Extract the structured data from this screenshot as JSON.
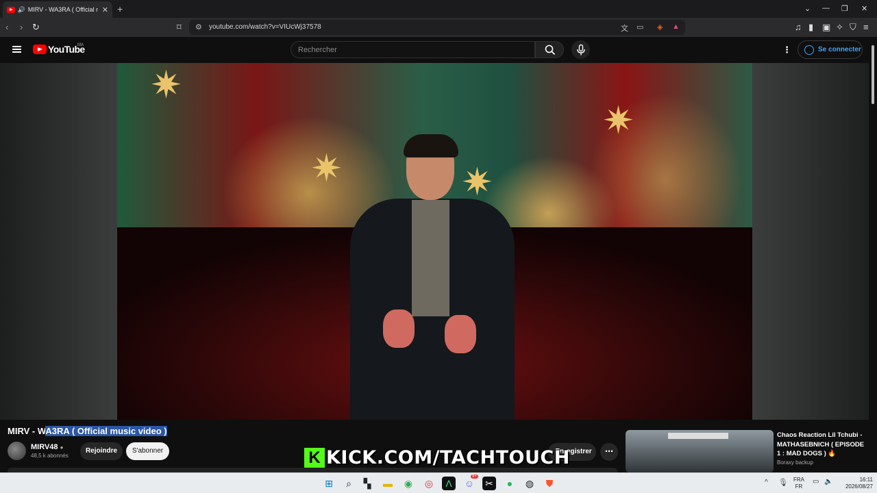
{
  "browser": {
    "tab_title": "MIRV - WA3RA ( Official music video )",
    "new_tab_label": "+",
    "url": "youtube.com/watch?v=VIUcWj37578"
  },
  "youtube": {
    "logo_text": "YouTube",
    "country_code": "MA",
    "search_placeholder": "Rechercher",
    "signin_label": "Se connecter"
  },
  "video": {
    "title_prefix": "MIRV - W",
    "title_selected": "A3RA ( Official music video )",
    "channel_name": "MIRV48",
    "subscribers": "48,5 k abonnés",
    "join_label": "Rejoindre",
    "subscribe_label": "S'abonner",
    "save_label": "Enregistrer",
    "overlay_text": "KICK.COM/TACHTOUCH",
    "overlay_logo": "K"
  },
  "recommendation": {
    "title": "Chaos Reaction Lil Tchubi - MATHASEBNICH ( EPISODE 1 : MAD DOGS ) 🔥",
    "channel": "Boraxy backup"
  },
  "taskbar": {
    "lang_top": "FRA",
    "lang_bottom": "FR",
    "time": "16:11",
    "date": "2026/08/27",
    "discord_badge": "9+"
  },
  "colors": {
    "accent_blue": "#3ea6ff",
    "youtube_red": "#ff0000",
    "kick_green": "#53fc18",
    "selection": "#2b57a5"
  }
}
